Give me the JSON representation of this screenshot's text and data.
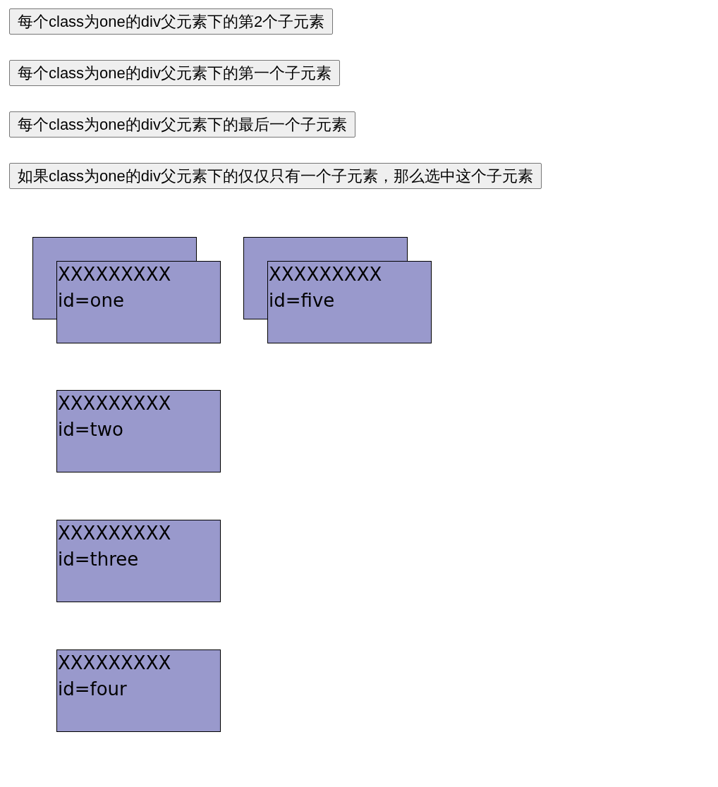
{
  "buttons": [
    {
      "label": "每个class为one的div父元素下的第2个子元素"
    },
    {
      "label": "每个class为one的div父元素下的第一个子元素"
    },
    {
      "label": "每个class为one的div父元素下的最后一个子元素"
    },
    {
      "label": "如果class为one的div父元素下的仅仅只有一个子元素，那么选中这个子元素"
    }
  ],
  "boxes": [
    {
      "kind": "stacked",
      "lines": [
        "XXXXXXXXX",
        "id=one"
      ]
    },
    {
      "kind": "stacked",
      "lines": [
        "XXXXXXXXX",
        "id=five"
      ]
    },
    {
      "kind": "single",
      "lines": [
        "XXXXXXXXX",
        "id=two"
      ]
    },
    {
      "kind": "single",
      "lines": [
        "XXXXXXXXX",
        "id=three"
      ]
    },
    {
      "kind": "single",
      "lines": [
        "XXXXXXXXX",
        "id=four"
      ]
    }
  ]
}
